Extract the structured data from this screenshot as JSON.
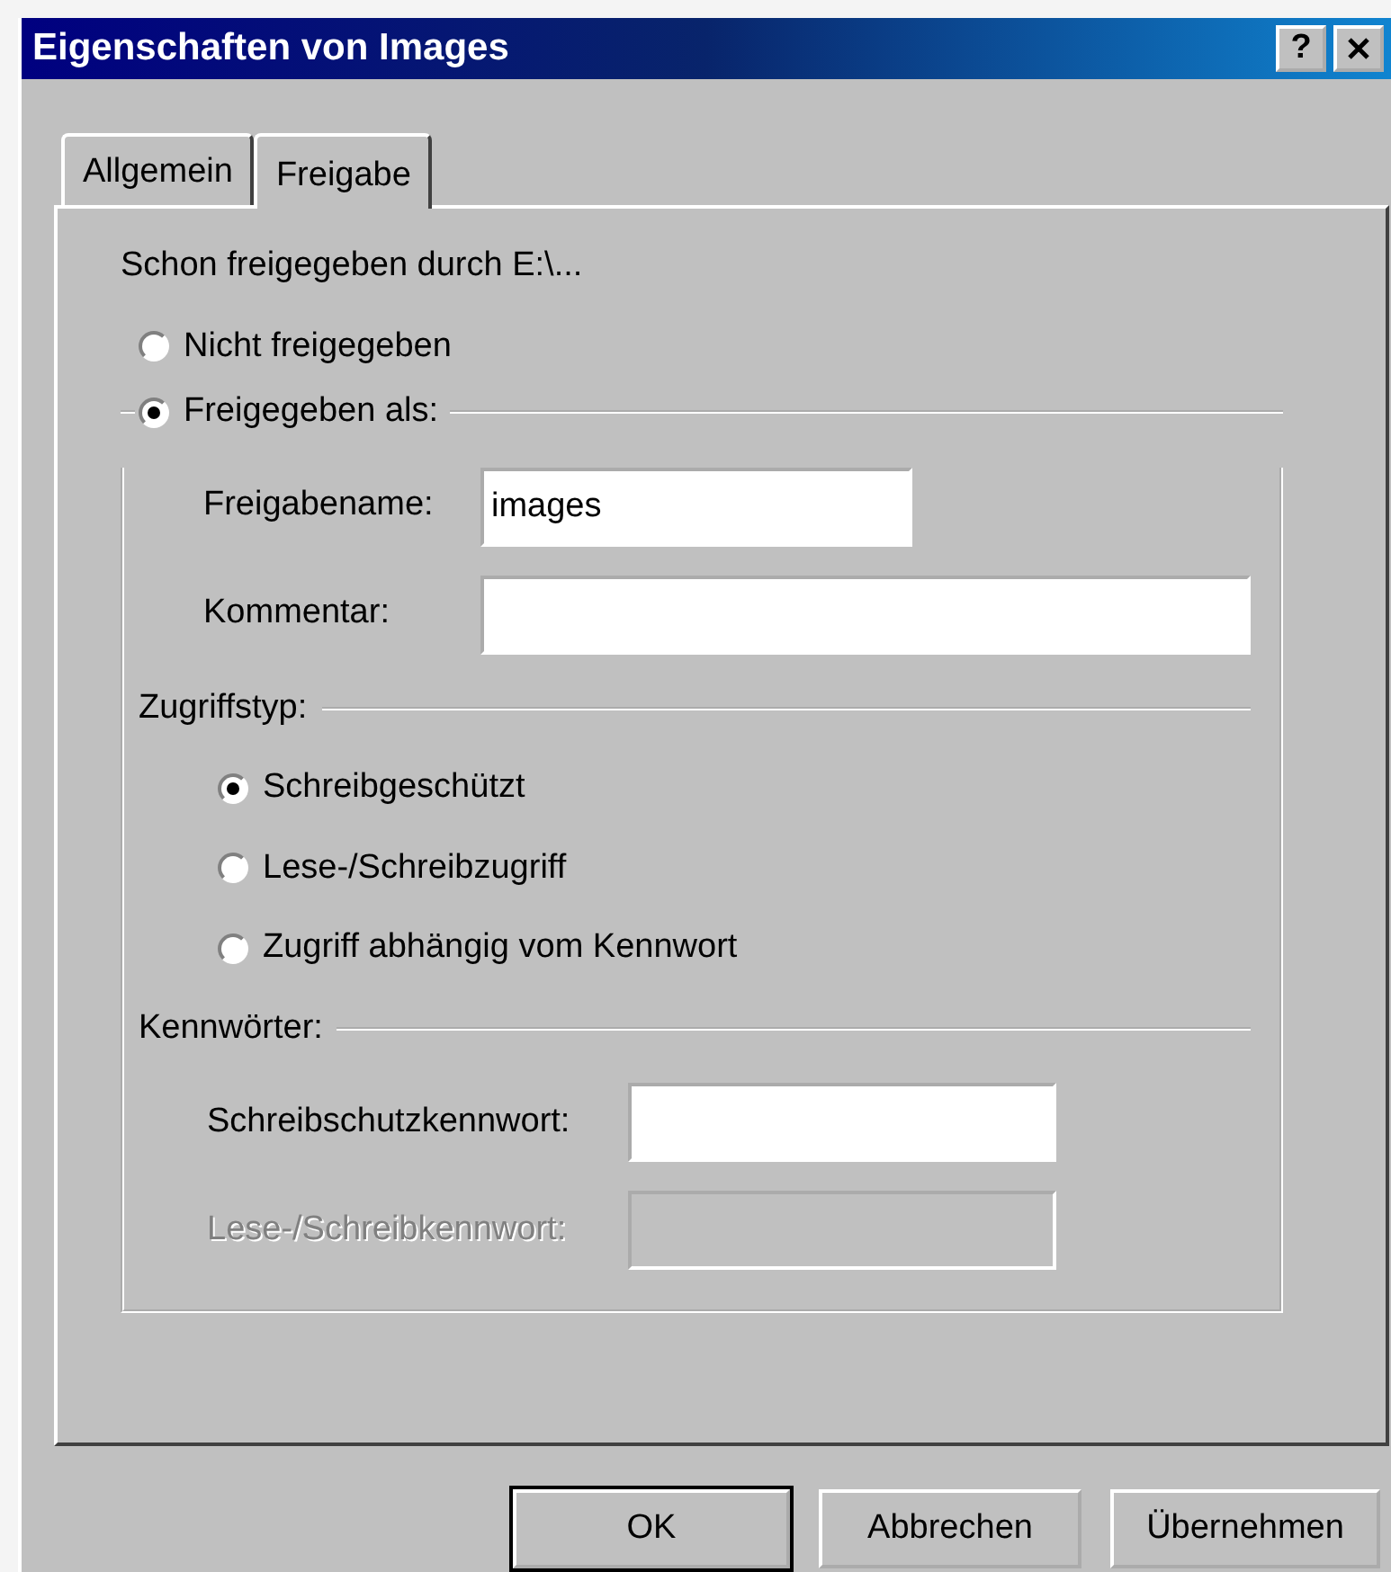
{
  "window": {
    "title": "Eigenschaften von Images",
    "help_button": "?"
  },
  "tabs": [
    {
      "label": "Allgemein",
      "selected": false
    },
    {
      "label": "Freigabe",
      "selected": true
    }
  ],
  "status_text": "Schon freigegeben durch E:\\...",
  "share_options": [
    {
      "label": "Nicht freigegeben",
      "selected": false
    },
    {
      "label": "Freigegeben als:",
      "selected": true
    }
  ],
  "share_fields": [
    {
      "label": "Freigabename:",
      "value": "images"
    },
    {
      "label": "Kommentar:"
    }
  ],
  "access_type": {
    "heading": "Zugriffstyp:",
    "options": [
      {
        "label": "Schreibgeschützt",
        "selected": true
      },
      {
        "label": "Lese-/Schreibzugriff",
        "selected": false
      },
      {
        "label": "Zugriff abhängig vom Kennwort",
        "selected": false
      }
    ]
  },
  "passwords": {
    "heading": "Kennwörter:",
    "fields": [
      {
        "label": "Schreibschutzkennwort:",
        "disabled": false
      },
      {
        "label": "Lese-/Schreibkennwort:",
        "disabled": true
      }
    ]
  },
  "buttons": [
    {
      "label": "OK",
      "default": true
    },
    {
      "label": "Abbrechen",
      "default": false
    },
    {
      "label": "Übernehmen",
      "default": false
    }
  ]
}
